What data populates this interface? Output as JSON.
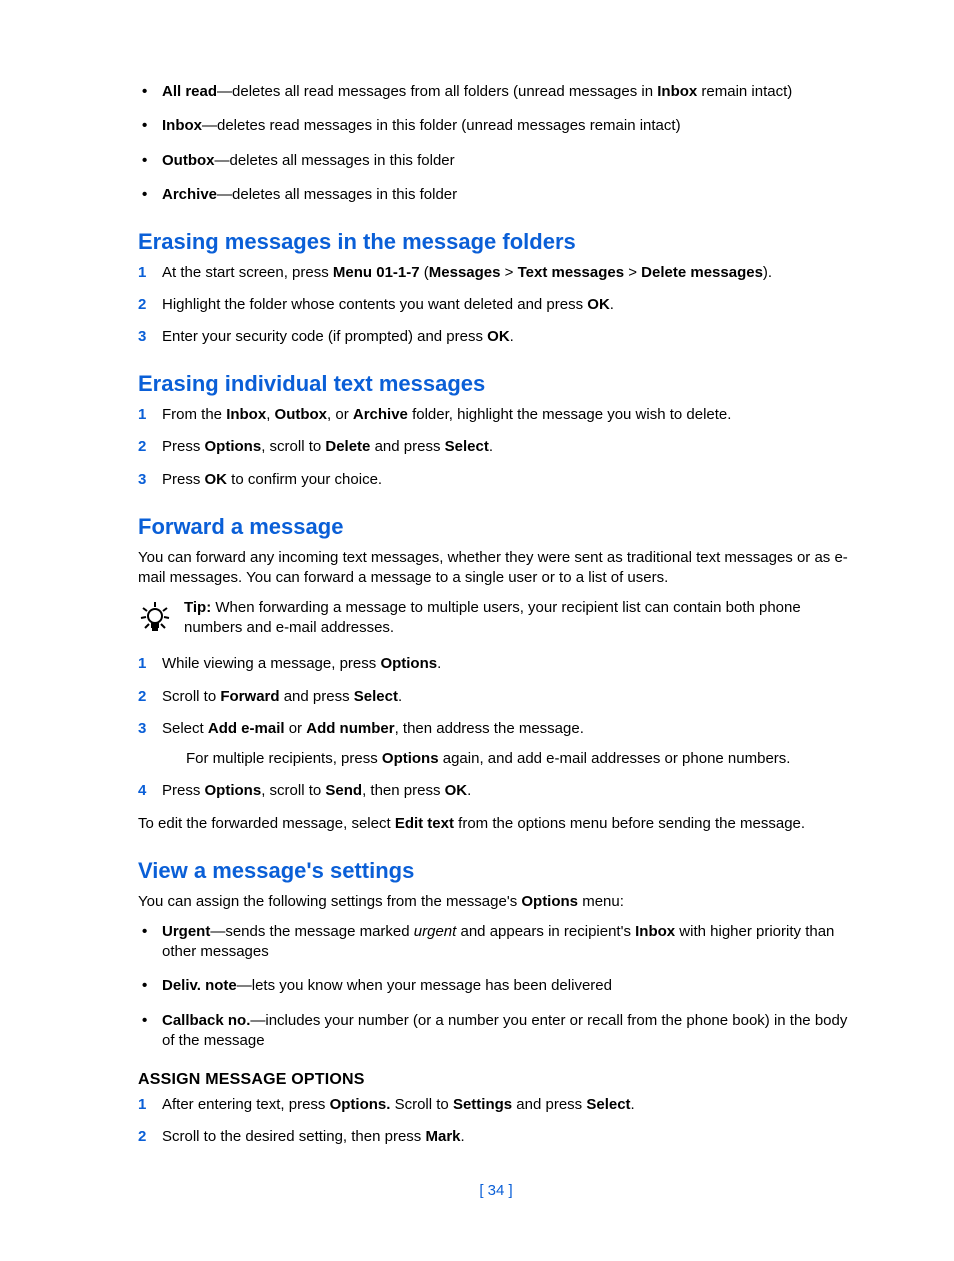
{
  "bullets_top": [
    {
      "term": "All read",
      "rest": "—deletes all read messages from all folders (unread messages in ",
      "term2": "Inbox",
      "tail": " remain intact)"
    },
    {
      "term": "Inbox",
      "rest": "—deletes read messages in this folder (unread messages remain intact)"
    },
    {
      "term": "Outbox",
      "rest": "—deletes all messages in this folder"
    },
    {
      "term": "Archive",
      "rest": "—deletes all messages in this folder"
    }
  ],
  "h_erasing_folders": "Erasing messages in the message folders",
  "steps_folders": {
    "s1a": "At the start screen, press ",
    "s1b": "Menu 01-1-7",
    "s1c": " (",
    "s1d": "Messages",
    "s1e": " > ",
    "s1f": "Text messages",
    "s1g": " > ",
    "s1h": "Delete messages",
    "s1i": ").",
    "s2a": "Highlight the folder whose contents you want deleted and press ",
    "s2b": "OK",
    "s2c": ".",
    "s3a": "Enter your security code (if prompted) and press ",
    "s3b": "OK",
    "s3c": "."
  },
  "h_erasing_individual": "Erasing individual text messages",
  "steps_individual": {
    "s1a": "From the ",
    "s1b": "Inbox",
    "s1c": ", ",
    "s1d": "Outbox",
    "s1e": ", or ",
    "s1f": "Archive",
    "s1g": " folder, highlight the message you wish to delete.",
    "s2a": "Press ",
    "s2b": "Options",
    "s2c": ", scroll to ",
    "s2d": "Delete",
    "s2e": " and press ",
    "s2f": "Select",
    "s2g": ".",
    "s3a": "Press ",
    "s3b": "OK",
    "s3c": " to confirm your choice."
  },
  "h_forward": "Forward a message",
  "p_forward": "You can forward any incoming text messages, whether they were sent as traditional text messages or as e-mail messages. You can forward a message to a single user or to a list of users.",
  "tip_label": "Tip:",
  "tip_text": " When forwarding a message to multiple users, your recipient list can contain both phone numbers and e-mail addresses.",
  "steps_forward": {
    "s1a": "While viewing a message, press ",
    "s1b": "Options",
    "s1c": ".",
    "s2a": "Scroll to ",
    "s2b": "Forward",
    "s2c": " and press ",
    "s2d": "Select",
    "s2e": ".",
    "s3a": "Select ",
    "s3b": "Add e-mail",
    "s3c": " or ",
    "s3d": "Add number",
    "s3e": ", then address the message.",
    "s3suba": "For multiple recipients, press ",
    "s3subb": "Options",
    "s3subc": " again, and add e-mail addresses or phone numbers.",
    "s4a": "Press ",
    "s4b": "Options",
    "s4c": ", scroll to ",
    "s4d": "Send",
    "s4e": ", then press ",
    "s4f": "OK",
    "s4g": "."
  },
  "p_forward_edit_a": "To edit the forwarded message, select ",
  "p_forward_edit_b": "Edit text",
  "p_forward_edit_c": " from the options menu before sending the message.",
  "h_view": "View a message's settings",
  "p_view_a": "You can assign the following settings from the message's ",
  "p_view_b": "Options",
  "p_view_c": " menu:",
  "bullets_view": {
    "b1a": "Urgent",
    "b1b": "—sends the message marked ",
    "b1c": "urgent",
    "b1d": " and appears in recipient's ",
    "b1e": "Inbox",
    "b1f": " with higher priority than other messages",
    "b2a": "Deliv. note",
    "b2b": "—lets you know when your message has been delivered",
    "b3a": "Callback no.",
    "b3b": "—includes your number (or a number you enter or recall from the phone book) in the body of the message"
  },
  "h_assign": "ASSIGN MESSAGE OPTIONS",
  "steps_assign": {
    "s1a": "After entering text, press ",
    "s1b": "Options.",
    "s1c": " Scroll to ",
    "s1d": "Settings",
    "s1e": " and press ",
    "s1f": "Select",
    "s1g": ".",
    "s2a": "Scroll to the desired setting, then press ",
    "s2b": "Mark",
    "s2c": "."
  },
  "page_number": "[ 34 ]"
}
